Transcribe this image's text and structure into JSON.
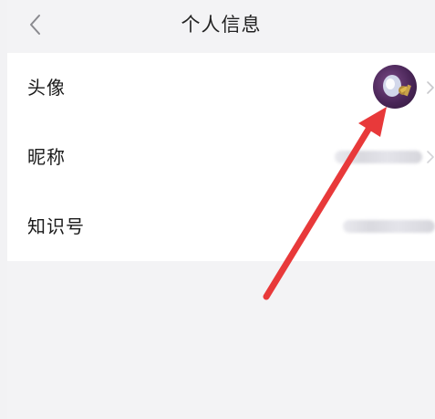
{
  "header": {
    "title": "个人信息"
  },
  "rows": [
    {
      "label": "头像"
    },
    {
      "label": "昵称"
    },
    {
      "label": "知识号"
    }
  ],
  "icons": {
    "back": "chevron-left-icon",
    "row_arrow": "chevron-right-icon"
  },
  "colors": {
    "annotation_arrow": "#e8393a",
    "background": "#f3f3f5",
    "card": "#ffffff"
  }
}
